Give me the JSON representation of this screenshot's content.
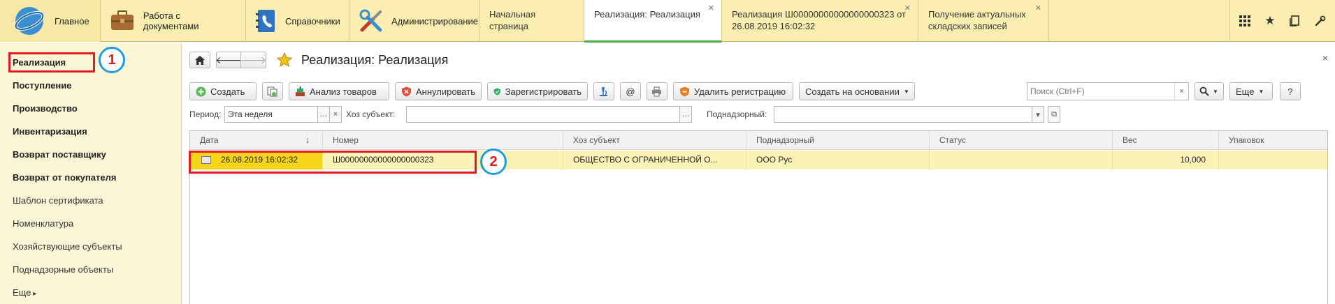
{
  "topbar": {
    "sections": [
      {
        "label": "Главное",
        "icon": "home-logo-icon"
      },
      {
        "label": "Работа с документами",
        "icon": "briefcase-icon"
      },
      {
        "label": "Справочники",
        "icon": "phonebook-icon"
      },
      {
        "label": "Администрирование",
        "icon": "tools-icon"
      }
    ],
    "tabs": [
      {
        "label": "Начальная страница",
        "closable": false
      },
      {
        "label": "Реализация: Реализация",
        "closable": true,
        "active": true
      },
      {
        "label": "Реализация Ш00000000000000000323 от 26.08.2019 16:02:32",
        "closable": true
      },
      {
        "label": "Получение актуальных складских записей",
        "closable": true
      }
    ],
    "right_icons": [
      "apps-grid-icon",
      "favorites-star-icon",
      "history-icon",
      "tools-icon"
    ]
  },
  "sidebar": {
    "items": [
      {
        "label": "Реализация",
        "bold": true
      },
      {
        "label": "Поступление",
        "bold": true
      },
      {
        "label": "Производство",
        "bold": true
      },
      {
        "label": "Инвентаризация",
        "bold": true
      },
      {
        "label": "Возврат поставщику",
        "bold": true
      },
      {
        "label": "Возврат от покупателя",
        "bold": true
      },
      {
        "label": "Шаблон сертификата",
        "bold": false
      },
      {
        "label": "Номенклатура",
        "bold": false
      },
      {
        "label": "Хозяйствующие субъекты",
        "bold": false
      },
      {
        "label": "Поднадзорные объекты",
        "bold": false
      },
      {
        "label": "Еще",
        "bold": false
      }
    ]
  },
  "main": {
    "title": "Реализация: Реализация",
    "close_glyph": "×",
    "toolbar": {
      "create": "Создать",
      "analyze": "Анализ товаров",
      "annul": "Аннулировать",
      "register": "Зарегистрировать",
      "at_glyph": "@",
      "delete_registration": "Удалить регистрацию",
      "create_based_on": "Создать на основании",
      "search_placeholder": "Поиск (Ctrl+F)",
      "more": "Еще",
      "help": "?"
    },
    "filters": {
      "period_label": "Период:",
      "period_value": "Эта неделя",
      "subject_label": "Хоз субъект:",
      "subject_value": "",
      "supervised_label": "Поднадзорный:",
      "supervised_value": ""
    },
    "table": {
      "columns": [
        "Дата",
        "Номер",
        "Хоз субъект",
        "Поднадзорный",
        "Статус",
        "Вес",
        "Упаковок"
      ],
      "sort_glyph": "↓",
      "rows": [
        {
          "date": "26.08.2019 16:02:32",
          "number": "Ш00000000000000000323",
          "subject": "ОБЩЕСТВО С ОГРАНИЧЕННОЙ О...",
          "supervised": "ООО Рус",
          "status": "",
          "weight": "10,000",
          "packages": ""
        }
      ]
    }
  },
  "annotations": {
    "badge_1": "1",
    "badge_2": "2",
    "highlight_color": "#e01b24",
    "badge_ring_color": "#1e9be0"
  },
  "colors": {
    "topbar_bg": "#fbeeb0",
    "sidebar_bg": "#fbf6d6",
    "selected_row_bg": "#fbf3b5",
    "selected_cell_bg": "#f6d418",
    "active_tab_underline": "#4caf50"
  }
}
